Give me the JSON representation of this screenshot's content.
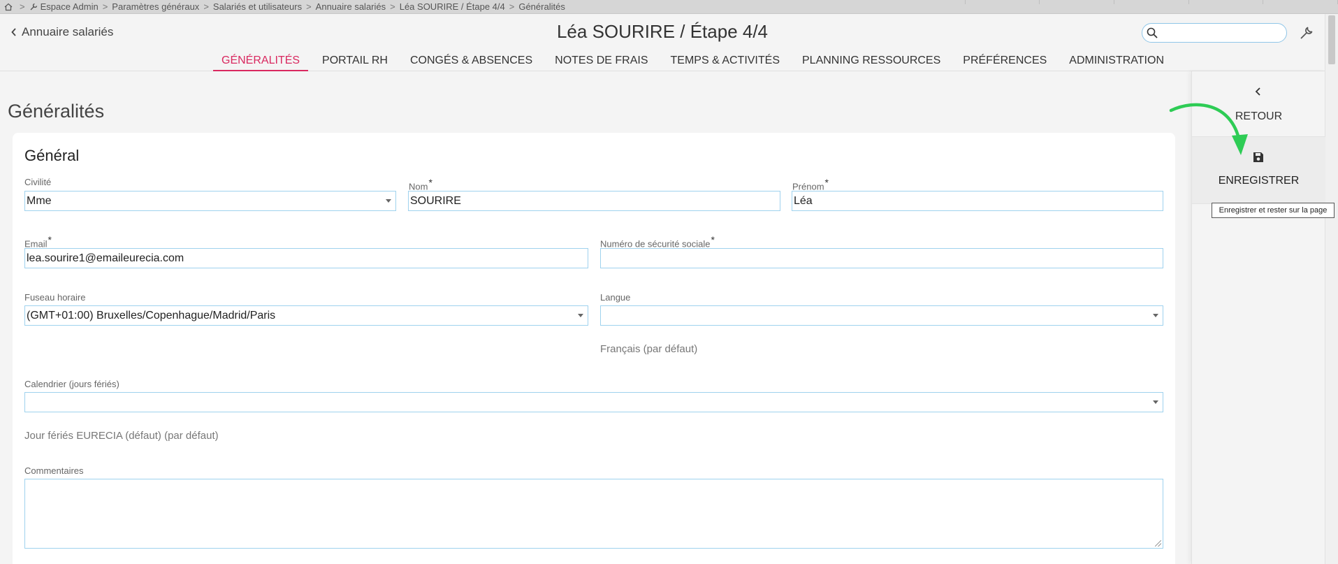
{
  "breadcrumb": {
    "items": [
      "Espace Admin",
      "Paramètres généraux",
      "Salariés et utilisateurs",
      "Annuaire salariés",
      "Léa SOURIRE / Étape 4/4",
      "Généralités"
    ],
    "separator": ">"
  },
  "header": {
    "back_label": "Annuaire salariés",
    "title": "Léa SOURIRE / Étape 4/4",
    "search_value": "",
    "tabs": [
      {
        "label": "GÉNÉRALITÉS",
        "active": true
      },
      {
        "label": "PORTAIL RH",
        "active": false
      },
      {
        "label": "CONGÉS & ABSENCES",
        "active": false
      },
      {
        "label": "NOTES DE FRAIS",
        "active": false
      },
      {
        "label": "TEMPS & ACTIVITÉS",
        "active": false
      },
      {
        "label": "PLANNING RESSOURCES",
        "active": false
      },
      {
        "label": "PRÉFÉRENCES",
        "active": false
      },
      {
        "label": "ADMINISTRATION",
        "active": false
      }
    ]
  },
  "main": {
    "section_title": "Généralités",
    "card_title": "Général",
    "fields": {
      "civilite": {
        "label": "Civilité",
        "value": "Mme"
      },
      "nom": {
        "label": "Nom",
        "required": "*",
        "value": "SOURIRE"
      },
      "prenom": {
        "label": "Prénom",
        "required": "*",
        "value": "Léa"
      },
      "email": {
        "label": "Email",
        "required": "*",
        "value": "lea.sourire1@emaileurecia.com"
      },
      "secu": {
        "label": "Numéro de sécurité sociale",
        "required": "*",
        "value": ""
      },
      "fuseau": {
        "label": "Fuseau horaire",
        "value": "(GMT+01:00) Bruxelles/Copenhague/Madrid/Paris"
      },
      "langue": {
        "label": "Langue",
        "value": "",
        "hint": "Français (par défaut)"
      },
      "calendrier": {
        "label": "Calendrier (jours fériés)",
        "value": "",
        "hint": "Jour fériés EURECIA (défaut) (par défaut)"
      },
      "commentaires": {
        "label": "Commentaires",
        "value": ""
      }
    }
  },
  "sidepanel": {
    "back_label": "RETOUR",
    "save_label": "ENREGISTRER",
    "save_tooltip": "Enregistrer et rester sur la page"
  },
  "colors": {
    "accent_tab": "#d9285f",
    "field_border": "#9fd2ee",
    "annotation_arrow": "#2ecc55"
  }
}
